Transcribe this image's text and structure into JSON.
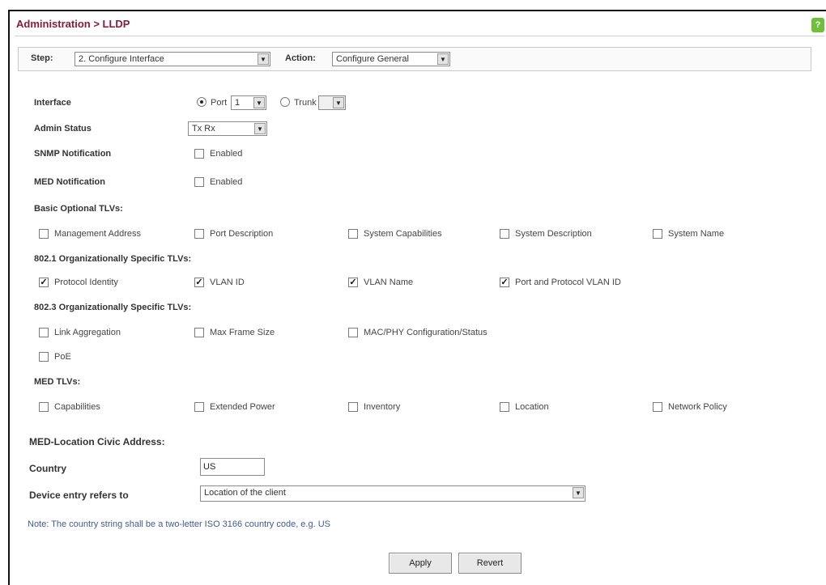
{
  "header": {
    "title": "Administration > LLDP",
    "help_icon": "help-icon"
  },
  "stepbar": {
    "step_label": "Step:",
    "step_value": "2. Configure Interface",
    "action_label": "Action:",
    "action_value": "Configure General"
  },
  "form": {
    "interface_label": "Interface",
    "port_label": "Port",
    "port_value": "1",
    "trunk_label": "Trunk",
    "trunk_value": "",
    "interface_selected": "Port",
    "admin_status_label": "Admin Status",
    "admin_status_value": "Tx Rx",
    "snmp_label": "SNMP Notification",
    "snmp_enabled_label": "Enabled",
    "snmp_checked": false,
    "med_label": "MED Notification",
    "med_enabled_label": "Enabled",
    "med_checked": false
  },
  "basic_tlvs": {
    "heading": "Basic Optional TLVs:",
    "items": [
      {
        "label": "Management Address",
        "checked": false
      },
      {
        "label": "Port Description",
        "checked": false
      },
      {
        "label": "System Capabilities",
        "checked": false
      },
      {
        "label": "System Description",
        "checked": false
      },
      {
        "label": "System Name",
        "checked": false
      }
    ]
  },
  "tlv_8021": {
    "heading": "802.1 Organizationally Specific TLVs:",
    "items": [
      {
        "label": "Protocol Identity",
        "checked": true
      },
      {
        "label": "VLAN ID",
        "checked": true
      },
      {
        "label": "VLAN Name",
        "checked": true
      },
      {
        "label": "Port and Protocol VLAN ID",
        "checked": true
      }
    ]
  },
  "tlv_8023": {
    "heading": "802.3 Organizationally Specific TLVs:",
    "items": [
      {
        "label": "Link Aggregation",
        "checked": false
      },
      {
        "label": "Max Frame Size",
        "checked": false
      },
      {
        "label": "MAC/PHY Configuration/Status",
        "checked": false
      },
      {
        "label": "PoE",
        "checked": false
      }
    ]
  },
  "med_tlvs": {
    "heading": "MED TLVs:",
    "items": [
      {
        "label": "Capabilities",
        "checked": false
      },
      {
        "label": "Extended Power",
        "checked": false
      },
      {
        "label": "Inventory",
        "checked": false
      },
      {
        "label": "Location",
        "checked": false
      },
      {
        "label": "Network Policy",
        "checked": false
      }
    ]
  },
  "civic": {
    "heading": "MED-Location Civic Address:",
    "country_label": "Country",
    "country_value": "US",
    "device_label": "Device entry refers to",
    "device_value": "Location of the client"
  },
  "note": "Note: The country string shall be a two-letter ISO 3166 country code, e.g. US",
  "buttons": {
    "apply": "Apply",
    "revert": "Revert"
  }
}
